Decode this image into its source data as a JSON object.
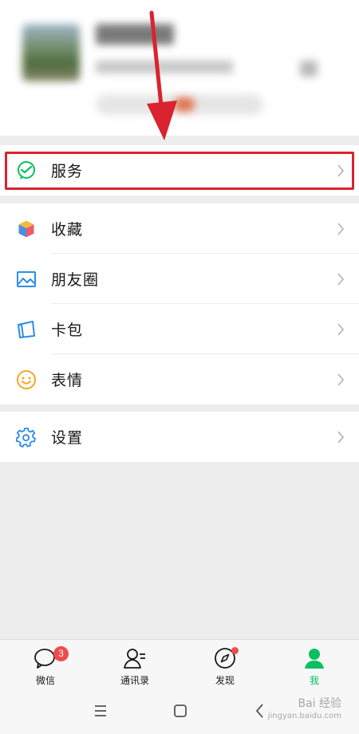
{
  "profile": {
    "avatar": "blurred-avatar",
    "note": ""
  },
  "service": {
    "label": "服务",
    "icon": "wechat-pay-icon",
    "accent": "#07c160",
    "highlight_color": "#d9242f"
  },
  "menu": [
    {
      "label": "收藏",
      "icon": "favorites-cube-icon"
    },
    {
      "label": "朋友圈",
      "icon": "moments-image-icon"
    },
    {
      "label": "卡包",
      "icon": "card-wallet-icon"
    },
    {
      "label": "表情",
      "icon": "sticker-smile-icon"
    }
  ],
  "settings": {
    "label": "设置",
    "icon": "gear-icon"
  },
  "tabs": [
    {
      "label": "微信",
      "icon": "chat-bubble-icon",
      "badge": "3"
    },
    {
      "label": "通讯录",
      "icon": "contacts-icon"
    },
    {
      "label": "发现",
      "icon": "compass-icon",
      "dot": true
    },
    {
      "label": "我",
      "icon": "me-person-icon",
      "active": true
    }
  ],
  "watermark": {
    "line1": "Bai 经验",
    "line2": "jingyan.baidu.com"
  },
  "colors": {
    "active_tab": "#07c160",
    "badge": "#f04b4b",
    "background": "#ededed"
  }
}
